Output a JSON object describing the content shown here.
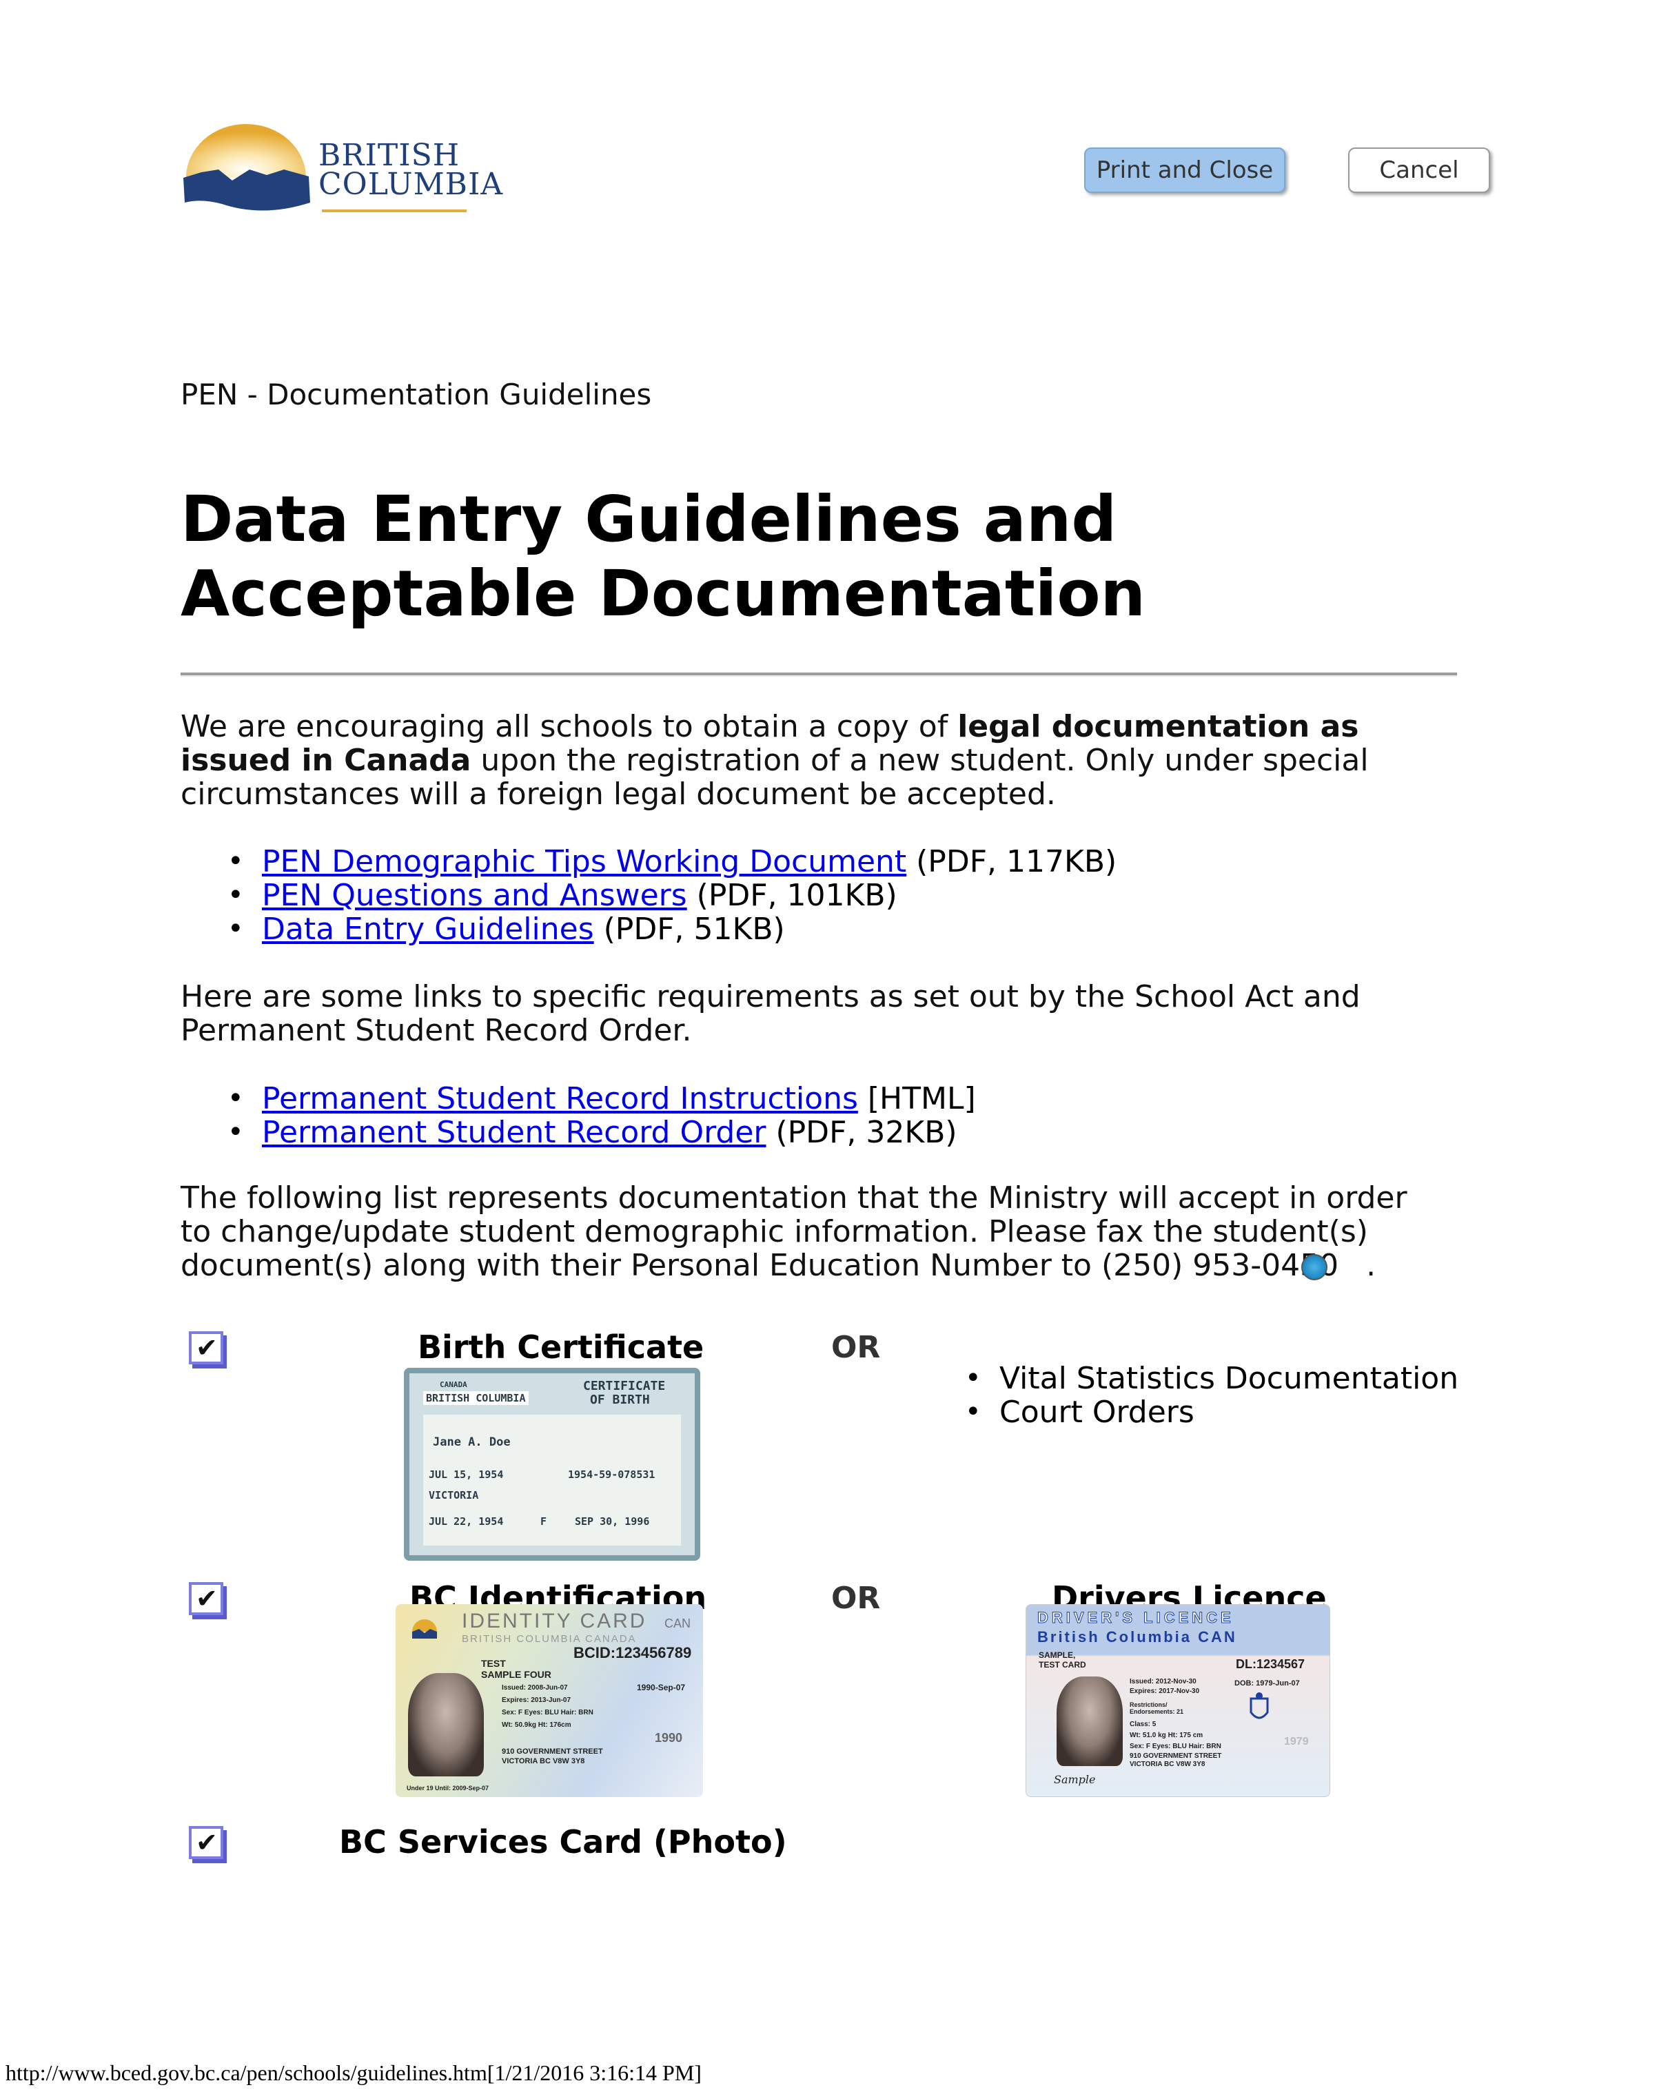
{
  "header": {
    "logo": {
      "line1": "BRITISH",
      "line2": "COLUMBIA"
    },
    "buttons": {
      "print_label": "Print and Close",
      "cancel_label": "Cancel"
    }
  },
  "breadcrumb": "PEN - Documentation Guidelines",
  "title": "Data Entry Guidelines and Acceptable Documentation",
  "intro": {
    "before_bold": "We are encouraging all schools to obtain a copy of ",
    "bold": "legal documentation as issued in Canada",
    "after_bold": " upon the registration of a new student. Only under special circumstances will a foreign legal document be accepted."
  },
  "resources": [
    {
      "link": "PEN Demographic Tips Working Document",
      "meta": " (PDF, 117KB)"
    },
    {
      "link": "PEN Questions and Answers",
      "meta": " (PDF, 101KB)"
    },
    {
      "link": "Data Entry Guidelines",
      "meta": " (PDF, 51KB)"
    }
  ],
  "requirements_intro": "Here are some links to specific requirements as set out by the School Act and Permanent Student Record Order.",
  "requirements": [
    {
      "link": "Permanent Student Record Instructions",
      "meta": " [HTML]"
    },
    {
      "link": "Permanent Student Record Order",
      "meta": " (PDF, 32KB)"
    }
  ],
  "fax_paragraph": {
    "text": "The following list represents documentation that the Ministry will accept in order to change/update student demographic information. Please fax the student(s) document(s) along with their Personal Education Number to (250) 953-0450",
    "end": "."
  },
  "documents": {
    "or_label": "OR",
    "row1": {
      "label": "Birth Certificate",
      "alternatives": [
        "Vital Statistics Documentation",
        "Court Orders"
      ],
      "image": {
        "header_left_1": "CANADA",
        "header_left_2": "BRITISH COLUMBIA",
        "header_right_1": "CERTIFICATE",
        "header_right_2": "OF BIRTH",
        "name": "Jane A. Doe",
        "birth_date": "JUL 15, 1954",
        "reg_no": "1954-59-078531",
        "place": "VICTORIA",
        "reg_date": "JUL 22, 1954",
        "sex": "F",
        "issued": "SEP 30, 1996"
      }
    },
    "row2": {
      "label": "BC Identification",
      "alt_label": "Drivers Licence",
      "bcid_image": {
        "title": "IDENTITY CARD",
        "country": "CAN",
        "subtitle": "BRITISH COLUMBIA CANADA",
        "id": "BCID:123456789",
        "name1": "TEST",
        "name2": "SAMPLE FOUR",
        "issued": "Issued: 2008-Jun-07",
        "expires": "Expires: 2013-Jun-07",
        "dob": "1990-Sep-07",
        "sex_eyes_hair": "Sex: F   Eyes: BLU   Hair: BRN",
        "wt_ht": "Wt: 50.9kg   Ht: 176cm",
        "year": "1990",
        "address1": "910 GOVERNMENT STREET",
        "address2": "VICTORIA BC V8W 3Y8",
        "under19": "Under 19 Until: 2009-Sep-07"
      },
      "dl_image": {
        "title": "DRIVER'S LICENCE",
        "subtitle": "British Columbia  CAN",
        "name1": "SAMPLE,",
        "name2": "TEST CARD",
        "id": "DL:1234567",
        "issued": "Issued: 2012-Nov-30",
        "expires": "Expires: 2017-Nov-30",
        "dob": "DOB: 1979-Jun-07",
        "restrictions": "Restrictions/ Endorsements: 21",
        "class": "Class: 5",
        "wt_ht": "Wt: 51.0 kg  Ht: 175 cm",
        "sex_eyes_hair": "Sex: F   Eyes: BLU   Hair: BRN",
        "address1": "910 GOVERNMENT STREET",
        "address2": "VICTORIA BC  V8W 3Y8",
        "year": "1979",
        "signature": "Sample"
      }
    },
    "row3": {
      "label": "BC Services Card (Photo)"
    }
  },
  "footer": "http://www.bced.gov.bc.ca/pen/schools/guidelines.htm[1/21/2016 3:16:14 PM]",
  "colors": {
    "link": "#0000ee",
    "print_button": "#9fc5ec",
    "logo_blue": "#1f3f7a",
    "logo_gold": "#e3ac3f",
    "checkbox": "#7c7ce0"
  }
}
